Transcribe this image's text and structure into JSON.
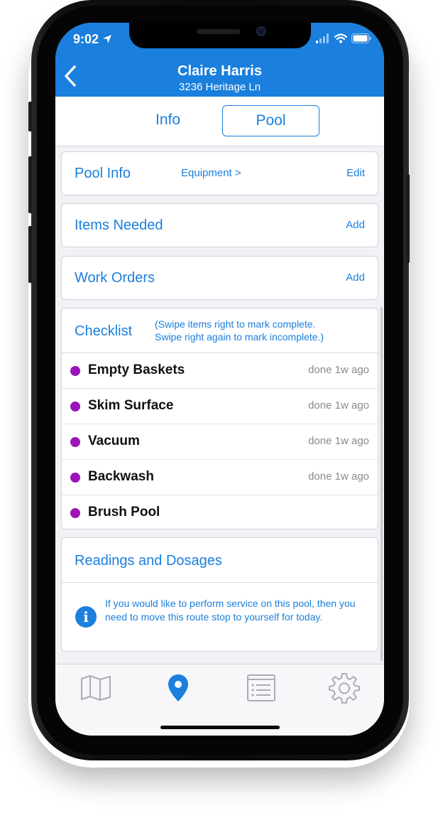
{
  "status_bar": {
    "time": "9:02"
  },
  "header": {
    "title": "Claire Harris",
    "subtitle": "3236 Heritage Ln"
  },
  "segments": {
    "info": "Info",
    "pool": "Pool",
    "selected": "Pool"
  },
  "pool_info": {
    "title": "Pool Info",
    "equipment_link": "Equipment >",
    "edit_label": "Edit"
  },
  "items_needed": {
    "title": "Items Needed",
    "add_label": "Add"
  },
  "work_orders": {
    "title": "Work Orders",
    "add_label": "Add"
  },
  "checklist": {
    "title": "Checklist",
    "hint": "(Swipe items right to mark complete.\nSwipe right again to mark incomplete.)",
    "items": [
      {
        "label": "Empty Baskets",
        "status": "done 1w ago"
      },
      {
        "label": "Skim Surface",
        "status": "done 1w ago"
      },
      {
        "label": "Vacuum",
        "status": "done 1w ago"
      },
      {
        "label": "Backwash",
        "status": "done 1w ago"
      },
      {
        "label": "Brush Pool",
        "status": ""
      }
    ],
    "dot_color": "#9b15b8"
  },
  "readings": {
    "title": "Readings and Dosages",
    "notice": "If you would like to perform service on this pool, then you need to move this route stop to yourself for today."
  },
  "tabbar": {
    "tabs": [
      {
        "icon": "map-icon",
        "active": false
      },
      {
        "icon": "location-pin-icon",
        "active": true
      },
      {
        "icon": "list-icon",
        "active": false
      },
      {
        "icon": "gear-icon",
        "active": false
      }
    ]
  },
  "colors": {
    "accent": "#1a7fdd",
    "text": "#111111",
    "muted": "#8a8a8e",
    "inactive_icon": "#a8adb5"
  }
}
